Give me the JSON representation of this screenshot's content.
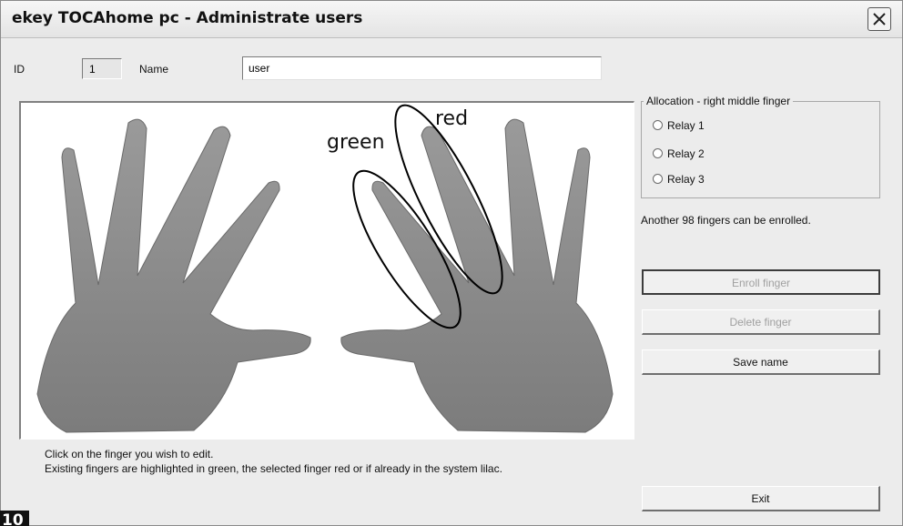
{
  "window": {
    "title": "ekey TOCAhome pc - Administrate users",
    "close_icon": "close-icon"
  },
  "user": {
    "id_label": "ID",
    "id_value": "1",
    "name_label": "Name",
    "name_value": "user"
  },
  "hands_image": {
    "annotations": {
      "green_label": "green",
      "red_label": "red"
    }
  },
  "instructions": {
    "line1": "Click on the finger you wish to edit.",
    "line2": "Existing fingers are highlighted in green, the selected finger red or if already in the system lilac."
  },
  "allocation": {
    "legend": "Allocation - right middle finger",
    "options": [
      {
        "label": "Relay 1",
        "selected": false
      },
      {
        "label": "Relay 2",
        "selected": false
      },
      {
        "label": "Relay 3",
        "selected": false
      }
    ]
  },
  "status": {
    "remaining": "Another 98 fingers can be enrolled."
  },
  "buttons": {
    "enroll": "Enroll finger",
    "delete": "Delete finger",
    "save_name": "Save name",
    "exit": "Exit"
  },
  "page_number": "10"
}
